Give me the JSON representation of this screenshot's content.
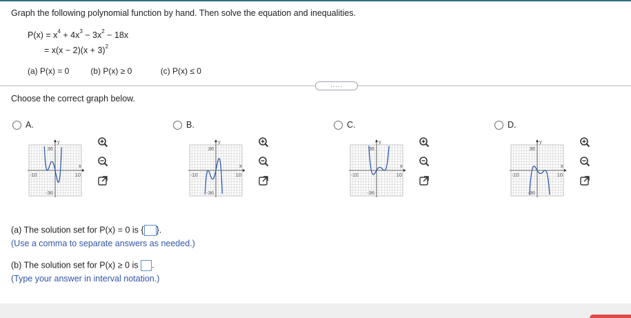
{
  "prompt": "Graph the following polynomial function by hand. Then solve the equation and inequalities.",
  "function": {
    "lhs": "P(x) = x",
    "e1": "4",
    "t2": " + 4x",
    "e2": "3",
    "t3": " − 3x",
    "e3": "2",
    "t4": " − 18x",
    "factored_main": "= x(x − 2)(x + 3)",
    "factored_exp": "2"
  },
  "parts": {
    "a": "(a) P(x) = 0",
    "b": "(b) P(x) ≥ 0",
    "c": "(c) P(x) ≤ 0"
  },
  "expand_dots": ".....",
  "choose": "Choose the correct graph below.",
  "options": [
    {
      "label": "A."
    },
    {
      "label": "B."
    },
    {
      "label": "C."
    },
    {
      "label": "D."
    }
  ],
  "graph_labels": {
    "y": "y",
    "x": "x",
    "ymax": "36",
    "ymin": "-36",
    "xmin": "-10",
    "xmax": "10"
  },
  "answers": {
    "a_text": "(a) The solution set for P(x) = 0 is {",
    "a_close": "}.",
    "a_hint": "(Use a comma to separate answers as needed.)",
    "b_text": "(b) The solution set for P(x) ≥ 0 is",
    "b_close": ".",
    "b_hint": "(Type your answer in interval notation.)"
  },
  "colors": {
    "accent": "#2b6e7a",
    "curve": "#1e4fa8",
    "input_border": "#5b8ed6",
    "hint": "#3355aa"
  },
  "icons": [
    "zoom-in-icon",
    "zoom-out-icon",
    "open-window-icon"
  ]
}
